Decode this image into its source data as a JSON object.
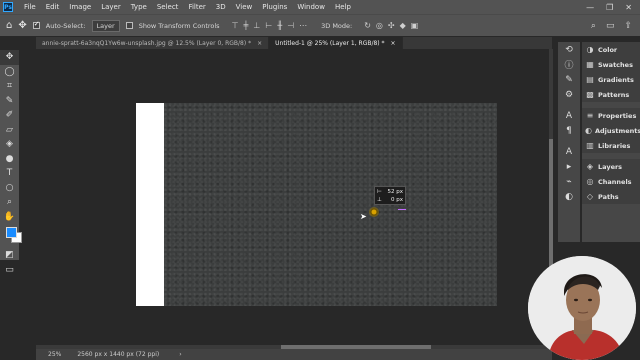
{
  "menubar": {
    "logo": "Ps",
    "items": [
      "File",
      "Edit",
      "Image",
      "Layer",
      "Type",
      "Select",
      "Filter",
      "3D",
      "View",
      "Plugins",
      "Window",
      "Help"
    ],
    "window_controls": [
      "—",
      "❐",
      "✕"
    ]
  },
  "options": {
    "auto_select_label": "Auto-Select:",
    "auto_select_value": "Layer",
    "transform_controls_label": "Show Transform Controls",
    "mode_3d_label": "3D Mode:"
  },
  "tabs": [
    {
      "label": "annie-spratt-6a3nqQ1Yw6w-unsplash.jpg @ 12.5% (Layer 0, RGB/8) *",
      "close": "×"
    },
    {
      "label": "Untitled-1 @ 25% (Layer 1, RGB/8) *",
      "close": "×"
    }
  ],
  "readout": {
    "dx_label": "⊢",
    "dx_value": "52 px",
    "dy_label": "⊥",
    "dy_value": "0 px"
  },
  "status": {
    "zoom": "25%",
    "doc_size": "2560 px x 1440 px (72 ppi)",
    "arrow": "›"
  },
  "panels": {
    "group1": [
      "Color",
      "Swatches",
      "Gradients",
      "Patterns"
    ],
    "group2": [
      "Properties",
      "Adjustments",
      "Libraries"
    ],
    "group3": [
      "Layers",
      "Channels",
      "Paths"
    ]
  },
  "colors": {
    "foreground": "#1a8cff",
    "background": "#ffffff",
    "ui_panel": "#535353",
    "workspace": "#282828"
  }
}
